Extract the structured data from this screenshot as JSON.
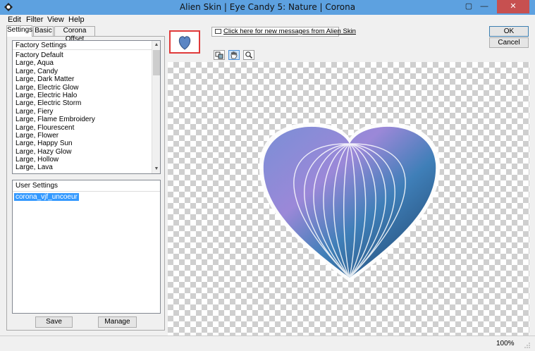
{
  "window": {
    "title": "Alien Skin | Eye Candy 5: Nature | Corona",
    "min": "—",
    "max": "▢",
    "close": "✕"
  },
  "menu": [
    "Edit",
    "Filter",
    "View",
    "Help"
  ],
  "tabs": [
    "Settings",
    "Basic",
    "Corona Offset"
  ],
  "factory": {
    "header": "Factory Settings",
    "items": [
      "Factory Default",
      "Large, Aqua",
      "Large, Candy",
      "Large, Dark Matter",
      "Large, Electric Glow",
      "Large, Electric Halo",
      "Large, Electric Storm",
      "Large, Fiery",
      "Large, Flame Embroidery",
      "Large, Flourescent",
      "Large, Flower",
      "Large, Happy Sun",
      "Large, Hazy Glow",
      "Large, Hollow",
      "Large, Lava"
    ]
  },
  "user": {
    "header": "User Settings",
    "selected": "corona_vjf_uncoeur"
  },
  "buttons": {
    "save": "Save",
    "manage": "Manage",
    "ok": "OK",
    "cancel": "Cancel"
  },
  "message": "Click here for new messages from Alien Skin",
  "status": {
    "zoom": "100%"
  },
  "colors": {
    "titlebar": "#5da1e0",
    "close": "#c75050",
    "selection": "#3399ff",
    "nav_border": "#e03a3a"
  }
}
